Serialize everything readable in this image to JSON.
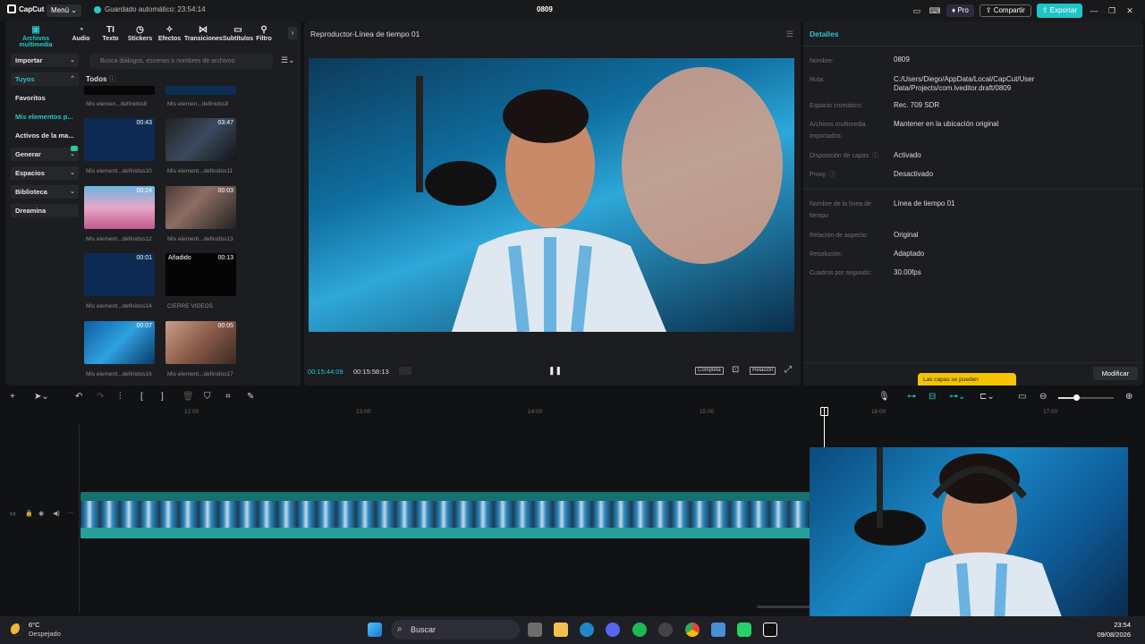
{
  "titlebar": {
    "app_name": "CapCut",
    "menu_label": "Menú",
    "autosave": "Guardado automático: 23:54:14",
    "project_title": "0809",
    "pro_label": "Pro",
    "share_label": "Compartir",
    "export_label": "Exportar"
  },
  "left_tabs": [
    {
      "label": "Archivos multimedia",
      "icon": "media-icon"
    },
    {
      "label": "Audio",
      "icon": "audio-icon"
    },
    {
      "label": "Texto",
      "icon": "text-icon"
    },
    {
      "label": "Stickers",
      "icon": "stickers-icon"
    },
    {
      "label": "Efectos",
      "icon": "effects-icon"
    },
    {
      "label": "Transiciones",
      "icon": "transitions-icon"
    },
    {
      "label": "Subtítulos",
      "icon": "subtitles-icon"
    },
    {
      "label": "Filtro",
      "icon": "filter-icon"
    }
  ],
  "sidebar": [
    {
      "label": "Importar"
    },
    {
      "label": "Tuyos"
    },
    {
      "label": "Favoritos"
    },
    {
      "label": "Mis elementos p..."
    },
    {
      "label": "Activos de la ma..."
    },
    {
      "label": "Generar"
    },
    {
      "label": "Espacios"
    },
    {
      "label": "Biblioteca"
    },
    {
      "label": "Dreamina"
    }
  ],
  "media": {
    "search_placeholder": "Busca diálogos, escenas o nombres de archivos",
    "section_label": "Todos",
    "items": [
      {
        "caption": "Mis elemen...definidos8",
        "duration": ""
      },
      {
        "caption": "Mis elemen...definidos9",
        "duration": ""
      },
      {
        "caption": "Mis element...definidos10",
        "duration": "00:43"
      },
      {
        "caption": "Mis element...definidos11",
        "duration": "03:47"
      },
      {
        "caption": "Mis element...definidos12",
        "duration": "00:24"
      },
      {
        "caption": "Mis element...definidos13",
        "duration": "00:03"
      },
      {
        "caption": "Mis element...definidos14",
        "duration": "00:01"
      },
      {
        "caption": "CIERRE VIDEOS",
        "duration": "00:13",
        "tag": "Añadido"
      },
      {
        "caption": "Mis element...definidos16",
        "duration": "00:07"
      },
      {
        "caption": "Mis element...definidos17",
        "duration": "00:05"
      }
    ]
  },
  "player": {
    "title": "Reproductor-Línea de tiempo 01",
    "current_time": "00:15:44:09",
    "total_time": "00:15:58:13",
    "quality_label": "Completa",
    "ratio_label": "Relación"
  },
  "details": {
    "title": "Detalles",
    "rows": [
      {
        "label": "Nombre:",
        "value": "0809"
      },
      {
        "label": "Ruta:",
        "value": "C:/Users/Diego/AppData/Local/CapCut/User Data/Projects/com.lveditor.draft/0809"
      },
      {
        "label": "Espacio cromático:",
        "value": "Rec. 709 SDR"
      },
      {
        "label": "Archivos multimedia importados:",
        "value": "Mantener en la ubicación original"
      },
      {
        "label": "Disposición de capas:",
        "value": "Activado"
      },
      {
        "label": "Proxy:",
        "value": "Desactivado"
      },
      {
        "label": "Nombre de la línea de tiempo",
        "value": "Línea de tiempo 01"
      },
      {
        "label": "Relación de aspecto:",
        "value": "Original"
      },
      {
        "label": "Resolución:",
        "value": "Adaptado"
      },
      {
        "label": "Cuadros por segundo:",
        "value": "30.00fps"
      }
    ],
    "tooltip": "Las capas se pueden",
    "modify_label": "Modificar"
  },
  "timeline": {
    "ruler_labels": [
      "12:00",
      "13:00",
      "14:00",
      "15:00",
      "16:00",
      "17:00"
    ]
  },
  "taskbar": {
    "temperature": "6°C",
    "weather": "Despejado",
    "search_label": "Buscar",
    "time": "23:54",
    "date": "09/08/2026"
  },
  "colors": {
    "accent": "#25c9c9",
    "export_button": "#1fc6c6",
    "tooltip": "#f5c400"
  }
}
